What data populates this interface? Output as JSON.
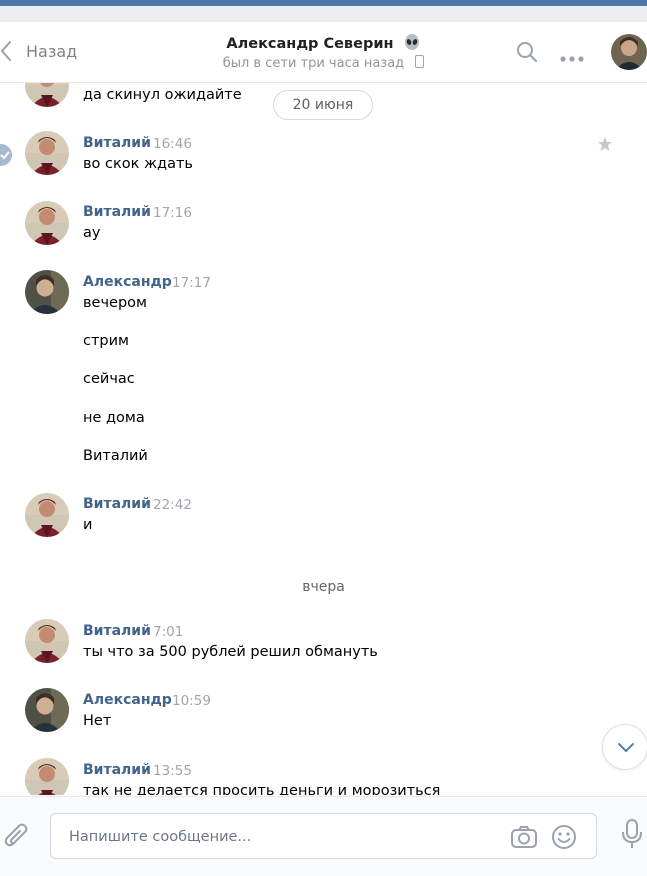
{
  "header": {
    "back_label": "Назад",
    "title": "Александр Северин",
    "title_emoji": "alien-emoji",
    "status": "был в сети три часа назад"
  },
  "colors": {
    "accent": "#4a76a8",
    "author": "#42648b",
    "muted": "#a0a5ab"
  },
  "feed": {
    "top_partial_text": "да скинул ожидайте",
    "date_divider_1": "20 июня",
    "date_divider_2": "вчера",
    "messages": [
      {
        "author": "Виталий",
        "time": "16:46",
        "lines": [
          "во скок ждать"
        ],
        "avatar": "vitaly"
      },
      {
        "author": "Виталий",
        "time": "17:16",
        "lines": [
          "ау"
        ],
        "avatar": "vitaly"
      },
      {
        "author": "Александр",
        "time": "17:17",
        "lines": [
          "вечером",
          "стрим",
          "сейчас",
          "не дома",
          "Виталий"
        ],
        "avatar": "alexander"
      },
      {
        "author": "Виталий",
        "time": "22:42",
        "lines": [
          "и"
        ],
        "avatar": "vitaly"
      },
      {
        "author": "Виталий",
        "time": "7:01",
        "lines": [
          "ты что за 500 рублей решил обмануть"
        ],
        "avatar": "vitaly"
      },
      {
        "author": "Александр",
        "time": "10:59",
        "lines": [
          "Нет"
        ],
        "avatar": "alexander"
      },
      {
        "author": "Виталий",
        "time": "13:55",
        "lines": [
          "так не делается просить деньги и морозиться"
        ],
        "avatar": "vitaly"
      }
    ]
  },
  "composer": {
    "placeholder": "Напишите сообщение..."
  }
}
